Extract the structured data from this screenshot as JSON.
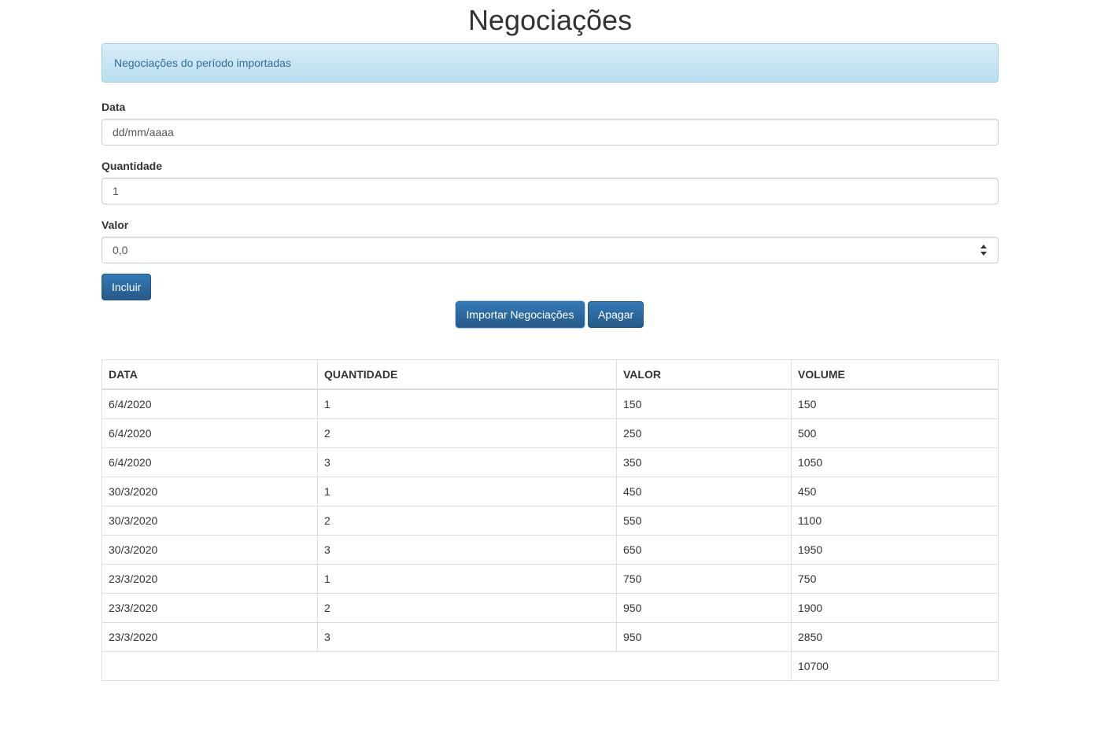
{
  "page": {
    "title": "Negociações"
  },
  "alert": {
    "message": "Negociações do período importadas"
  },
  "form": {
    "data": {
      "label": "Data",
      "placeholder": "dd/mm/aaaa"
    },
    "quantidade": {
      "label": "Quantidade",
      "value": "1"
    },
    "valor": {
      "label": "Valor",
      "value": "0,0"
    },
    "incluir_label": "Incluir"
  },
  "actions": {
    "importar_label": "Importar Negociações",
    "apagar_label": "Apagar"
  },
  "table": {
    "headers": [
      "DATA",
      "QUANTIDADE",
      "VALOR",
      "VOLUME"
    ],
    "rows": [
      [
        "6/4/2020",
        "1",
        "150",
        "150"
      ],
      [
        "6/4/2020",
        "2",
        "250",
        "500"
      ],
      [
        "6/4/2020",
        "3",
        "350",
        "1050"
      ],
      [
        "30/3/2020",
        "1",
        "450",
        "450"
      ],
      [
        "30/3/2020",
        "2",
        "550",
        "1100"
      ],
      [
        "30/3/2020",
        "3",
        "650",
        "1950"
      ],
      [
        "23/3/2020",
        "1",
        "750",
        "750"
      ],
      [
        "23/3/2020",
        "2",
        "950",
        "1900"
      ],
      [
        "23/3/2020",
        "3",
        "950",
        "2850"
      ]
    ],
    "total_volume": "10700"
  },
  "colors": {
    "primary": "#337ab7",
    "alert_bg": "#d9edf7",
    "alert_text": "#31708f"
  }
}
